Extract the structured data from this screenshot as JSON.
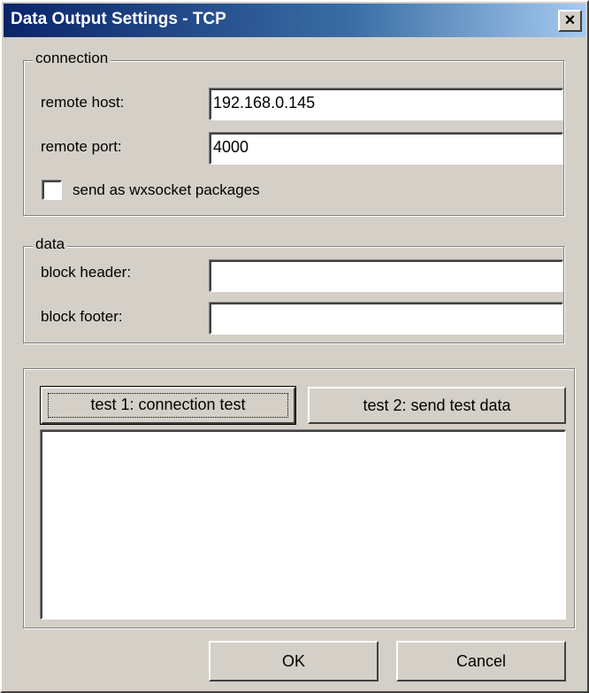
{
  "window": {
    "title": "Data Output Settings - TCP",
    "close_glyph": "×"
  },
  "connection": {
    "legend": "connection",
    "remote_host_label": "remote host:",
    "remote_host_value": "192.168.0.145",
    "remote_port_label": "remote port:",
    "remote_port_value": "4000",
    "wxsocket_label": "send as wxsocket packages",
    "wxsocket_checked": false
  },
  "data": {
    "legend": "data",
    "block_header_label": "block header:",
    "block_header_value": "",
    "block_footer_label": "block footer:",
    "block_footer_value": ""
  },
  "tests": {
    "test1_label": "test 1: connection test",
    "test2_label": "test 2: send test data",
    "output_text": ""
  },
  "footer": {
    "ok_label": "OK",
    "cancel_label": "Cancel"
  }
}
